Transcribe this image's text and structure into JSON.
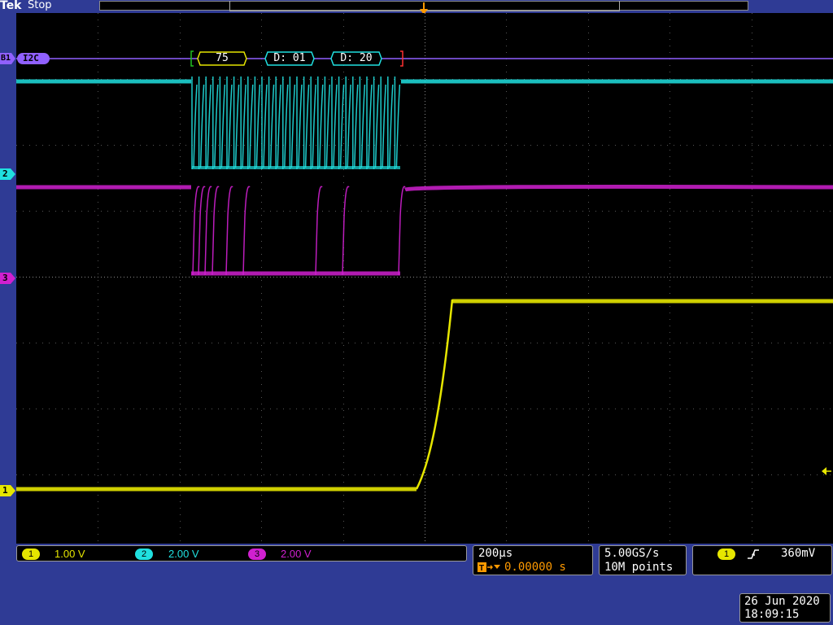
{
  "header": {
    "brand": "Tek",
    "run_state": "Stop",
    "trigger_marker": "T"
  },
  "bus": {
    "label": "I2C",
    "marker": "B1",
    "packets": [
      "75",
      "D: 01",
      "D: 20"
    ]
  },
  "channels": [
    {
      "marker": "1",
      "color": "#e6e600",
      "scale": "1.00 V"
    },
    {
      "marker": "2",
      "color": "#20e0e0",
      "scale": "2.00 V"
    },
    {
      "marker": "3",
      "color": "#d020d0",
      "scale": "2.00 V"
    }
  ],
  "channel3_marker": "3",
  "timebase": {
    "scale": "200µs",
    "position": "0.00000 s",
    "sample_rate": "5.00GS/s",
    "record_length": "10M points"
  },
  "trigger": {
    "source": "1",
    "slope_icon": "rising-edge-icon",
    "level": "360mV"
  },
  "datetime": {
    "date": "26 Jun 2020",
    "time": "18:09:15"
  },
  "colors": {
    "background": "#2f3b95",
    "ch1": "#e6e600",
    "ch2": "#20e0e0",
    "ch3": "#d020d0",
    "bus": "#9060ff"
  }
}
